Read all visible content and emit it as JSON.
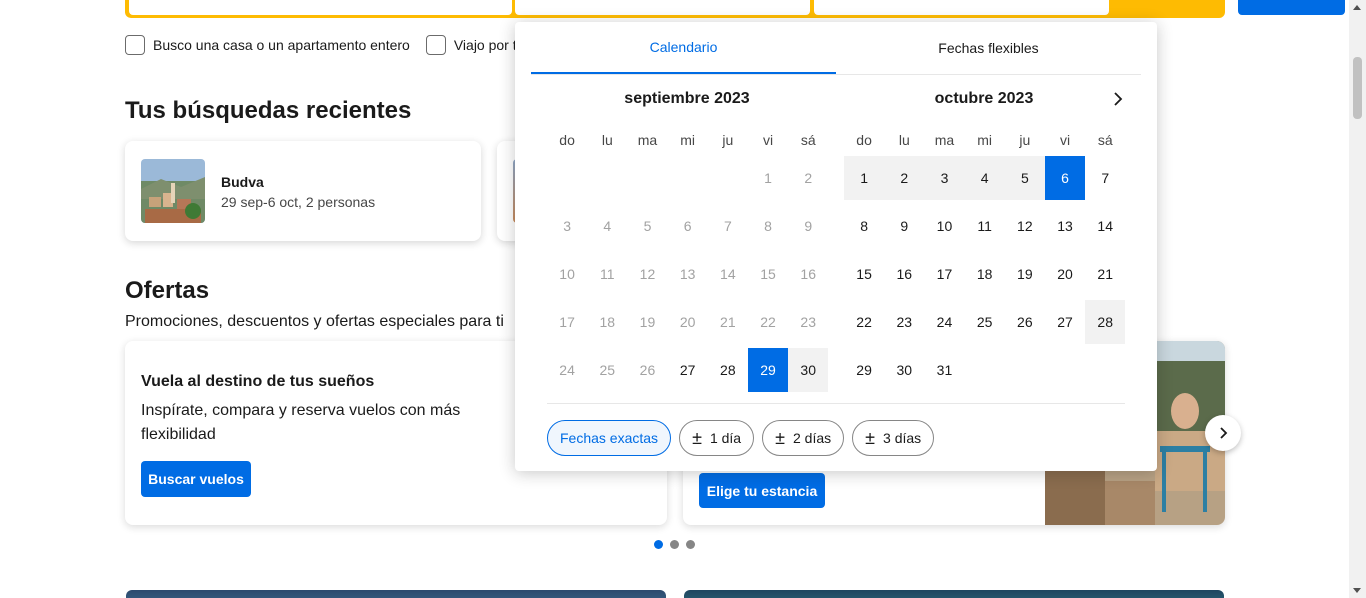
{
  "checks": [
    {
      "label": "Busco una casa o un apartamento entero"
    },
    {
      "label": "Viajo por t"
    }
  ],
  "recent": {
    "heading": "Tus búsquedas recientes",
    "card": {
      "title": "Budva",
      "subtitle": "29 sep-6 oct, 2 personas"
    }
  },
  "offers": {
    "heading": "Ofertas",
    "subheading": "Promociones, descuentos y ofertas especiales para ti",
    "card1": {
      "title": "Vuela al destino de tus sueños",
      "desc": "Inspírate, compara y reserva vuelos con más flexibilidad",
      "button": "Buscar vuelos"
    },
    "card2": {
      "button": "Elige tu estancia"
    }
  },
  "calendar": {
    "tabs": [
      "Calendario",
      "Fechas flexibles"
    ],
    "weekdays": [
      "do",
      "lu",
      "ma",
      "mi",
      "ju",
      "vi",
      "sá"
    ],
    "months": [
      {
        "title": "septiembre 2023"
      },
      {
        "title": "octubre 2023"
      }
    ],
    "flex_options": [
      {
        "label": "Fechas exactas"
      },
      {
        "label": "1 día"
      },
      {
        "label": "2 días"
      },
      {
        "label": "3 días"
      }
    ],
    "plus_minus": "±"
  },
  "colors": {
    "accent": "#006ce4",
    "search_border": "#febb02"
  }
}
